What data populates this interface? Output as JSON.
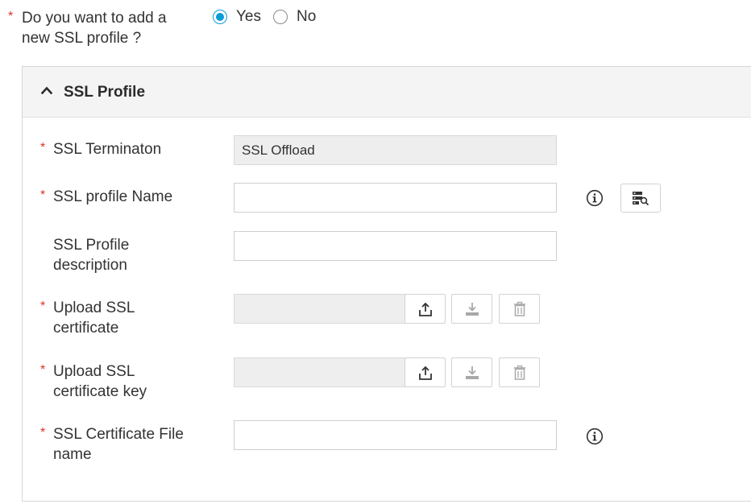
{
  "question": {
    "required_mark": "*",
    "line1": "Do you want to add a",
    "line2": "new SSL profile ?",
    "options": [
      {
        "label": "Yes",
        "selected": true
      },
      {
        "label": "No",
        "selected": false
      }
    ]
  },
  "panel": {
    "title": "SSL Profile",
    "expanded": true
  },
  "fields": {
    "termination": {
      "required_mark": "*",
      "label": "SSL Terminaton",
      "value": "SSL Offload"
    },
    "profile_name": {
      "required_mark": "*",
      "label": "SSL profile Name",
      "value": ""
    },
    "description": {
      "label_line1": "SSL Profile",
      "label_line2": "description",
      "value": ""
    },
    "certificate": {
      "required_mark": "*",
      "label_line1": "Upload SSL",
      "label_line2": "certificate"
    },
    "certificate_key": {
      "required_mark": "*",
      "label_line1": "Upload SSL",
      "label_line2": "certificate key"
    },
    "cert_file_name": {
      "required_mark": "*",
      "label_line1": "SSL Certificate File",
      "label_line2": "name",
      "value": ""
    }
  },
  "icons": {
    "info": "info-circle-icon",
    "lookup": "server-search-icon",
    "upload": "upload-icon",
    "download": "download-icon",
    "delete": "trash-icon",
    "collapse": "chevron-up-icon"
  },
  "colors": {
    "accent": "#0b9ad8",
    "required": "#e0302a",
    "panel_header_bg": "#f4f4f4",
    "readonly_bg": "#eeeeee"
  }
}
